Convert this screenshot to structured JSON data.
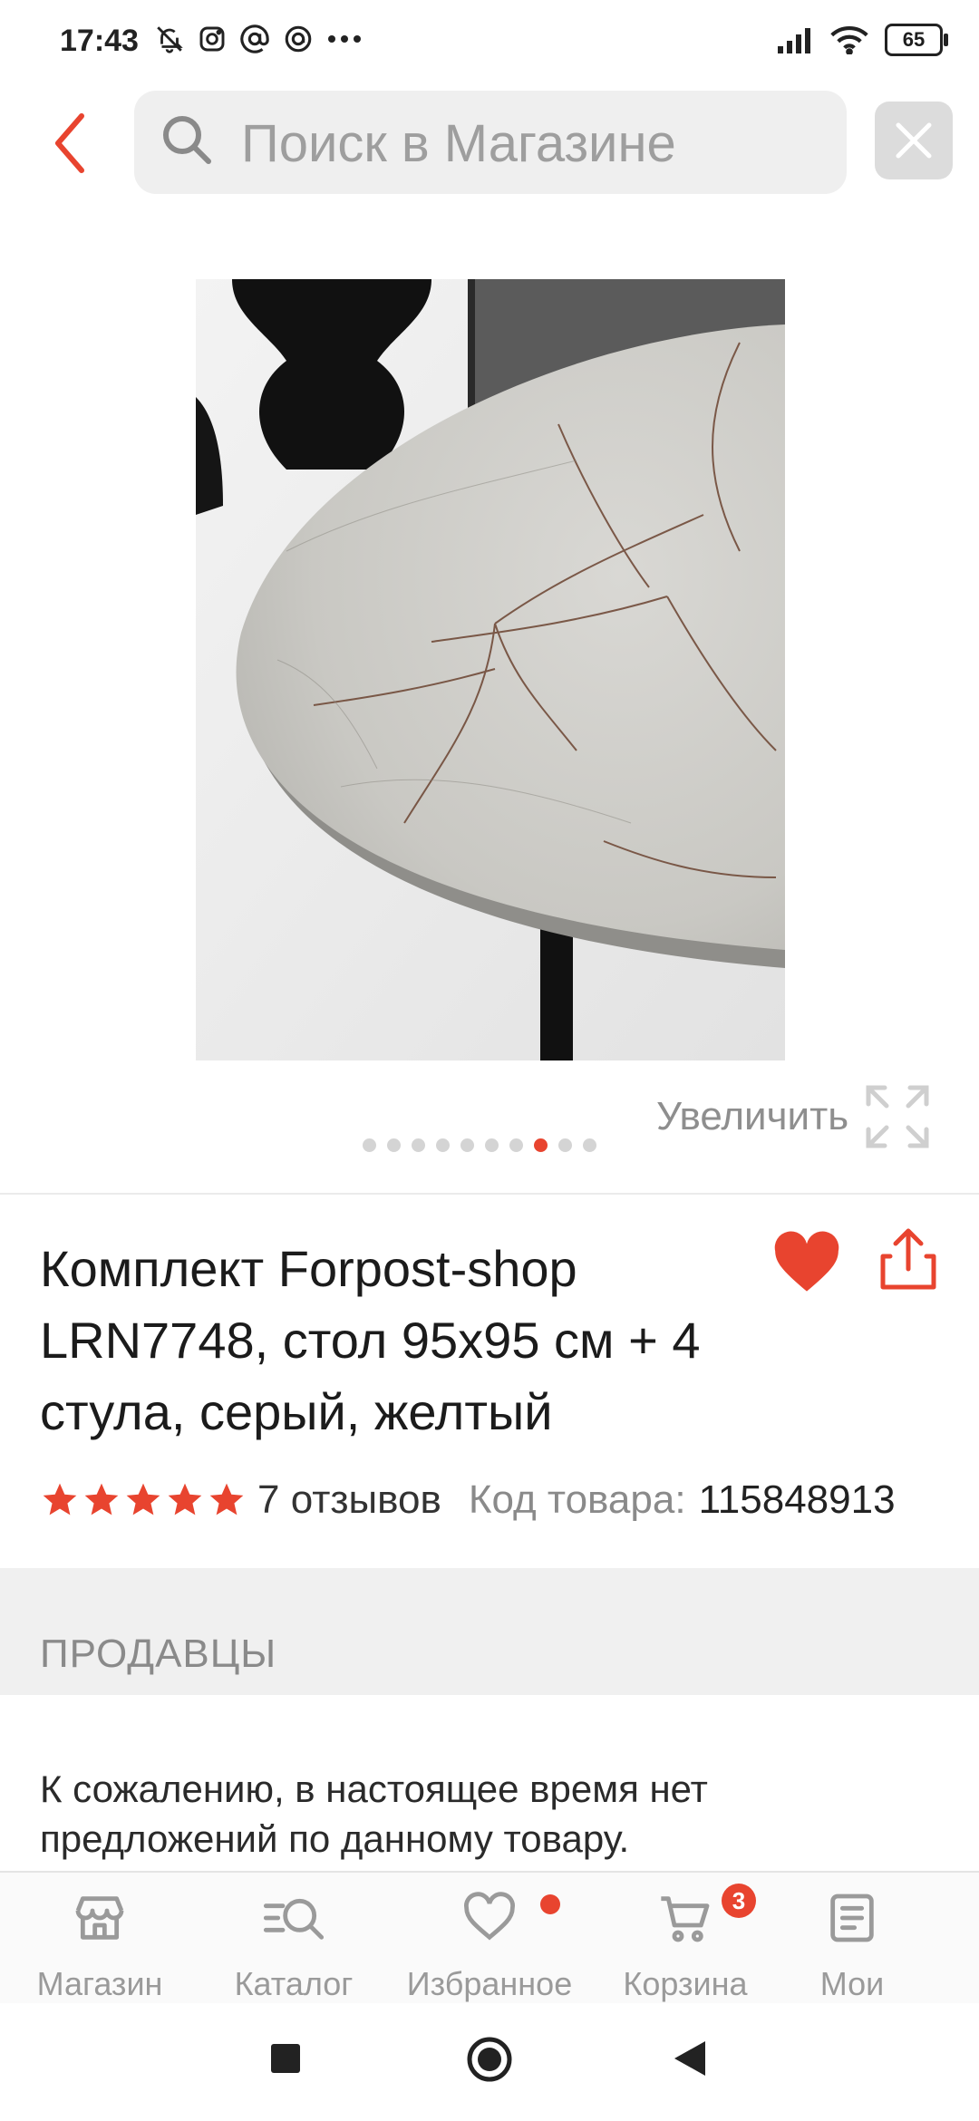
{
  "status_bar": {
    "time": "17:43",
    "left_icons": [
      "bell-off-icon",
      "instagram-icon",
      "at-icon",
      "threads-icon",
      "more-dots-icon"
    ],
    "right_icons": [
      "signal-icon",
      "wifi-icon"
    ],
    "battery": "65"
  },
  "search": {
    "placeholder": "Поиск в Магазине",
    "value": ""
  },
  "gallery": {
    "zoom_label": "Увеличить",
    "total_images": 10,
    "active_index": 8
  },
  "product": {
    "title": "Комплект Forpost-shop LRN7748, стол 95x95 см + 4 стула, серый, желтый",
    "rating": 5,
    "reviews": "7 отзывов",
    "code_label": "Код товара:",
    "code_value": "115848913",
    "favorite": true
  },
  "sellers": {
    "title": "ПРОДАВЦЫ",
    "empty_message": "К сожалению, в настоящее время нет предложений по данному товару."
  },
  "bottom_nav": [
    {
      "label": "Магазин",
      "icon": "store-icon"
    },
    {
      "label": "Каталог",
      "icon": "catalog-search-icon"
    },
    {
      "label": "Избранное",
      "icon": "heart-outline-icon",
      "has_dot": true
    },
    {
      "label": "Корзина",
      "icon": "cart-icon",
      "badge": "3"
    },
    {
      "label": "Мои",
      "icon": "orders-icon"
    }
  ],
  "colors": {
    "accent": "#e8442f",
    "muted_text": "#8e8e8e",
    "search_bg": "#efefef"
  }
}
